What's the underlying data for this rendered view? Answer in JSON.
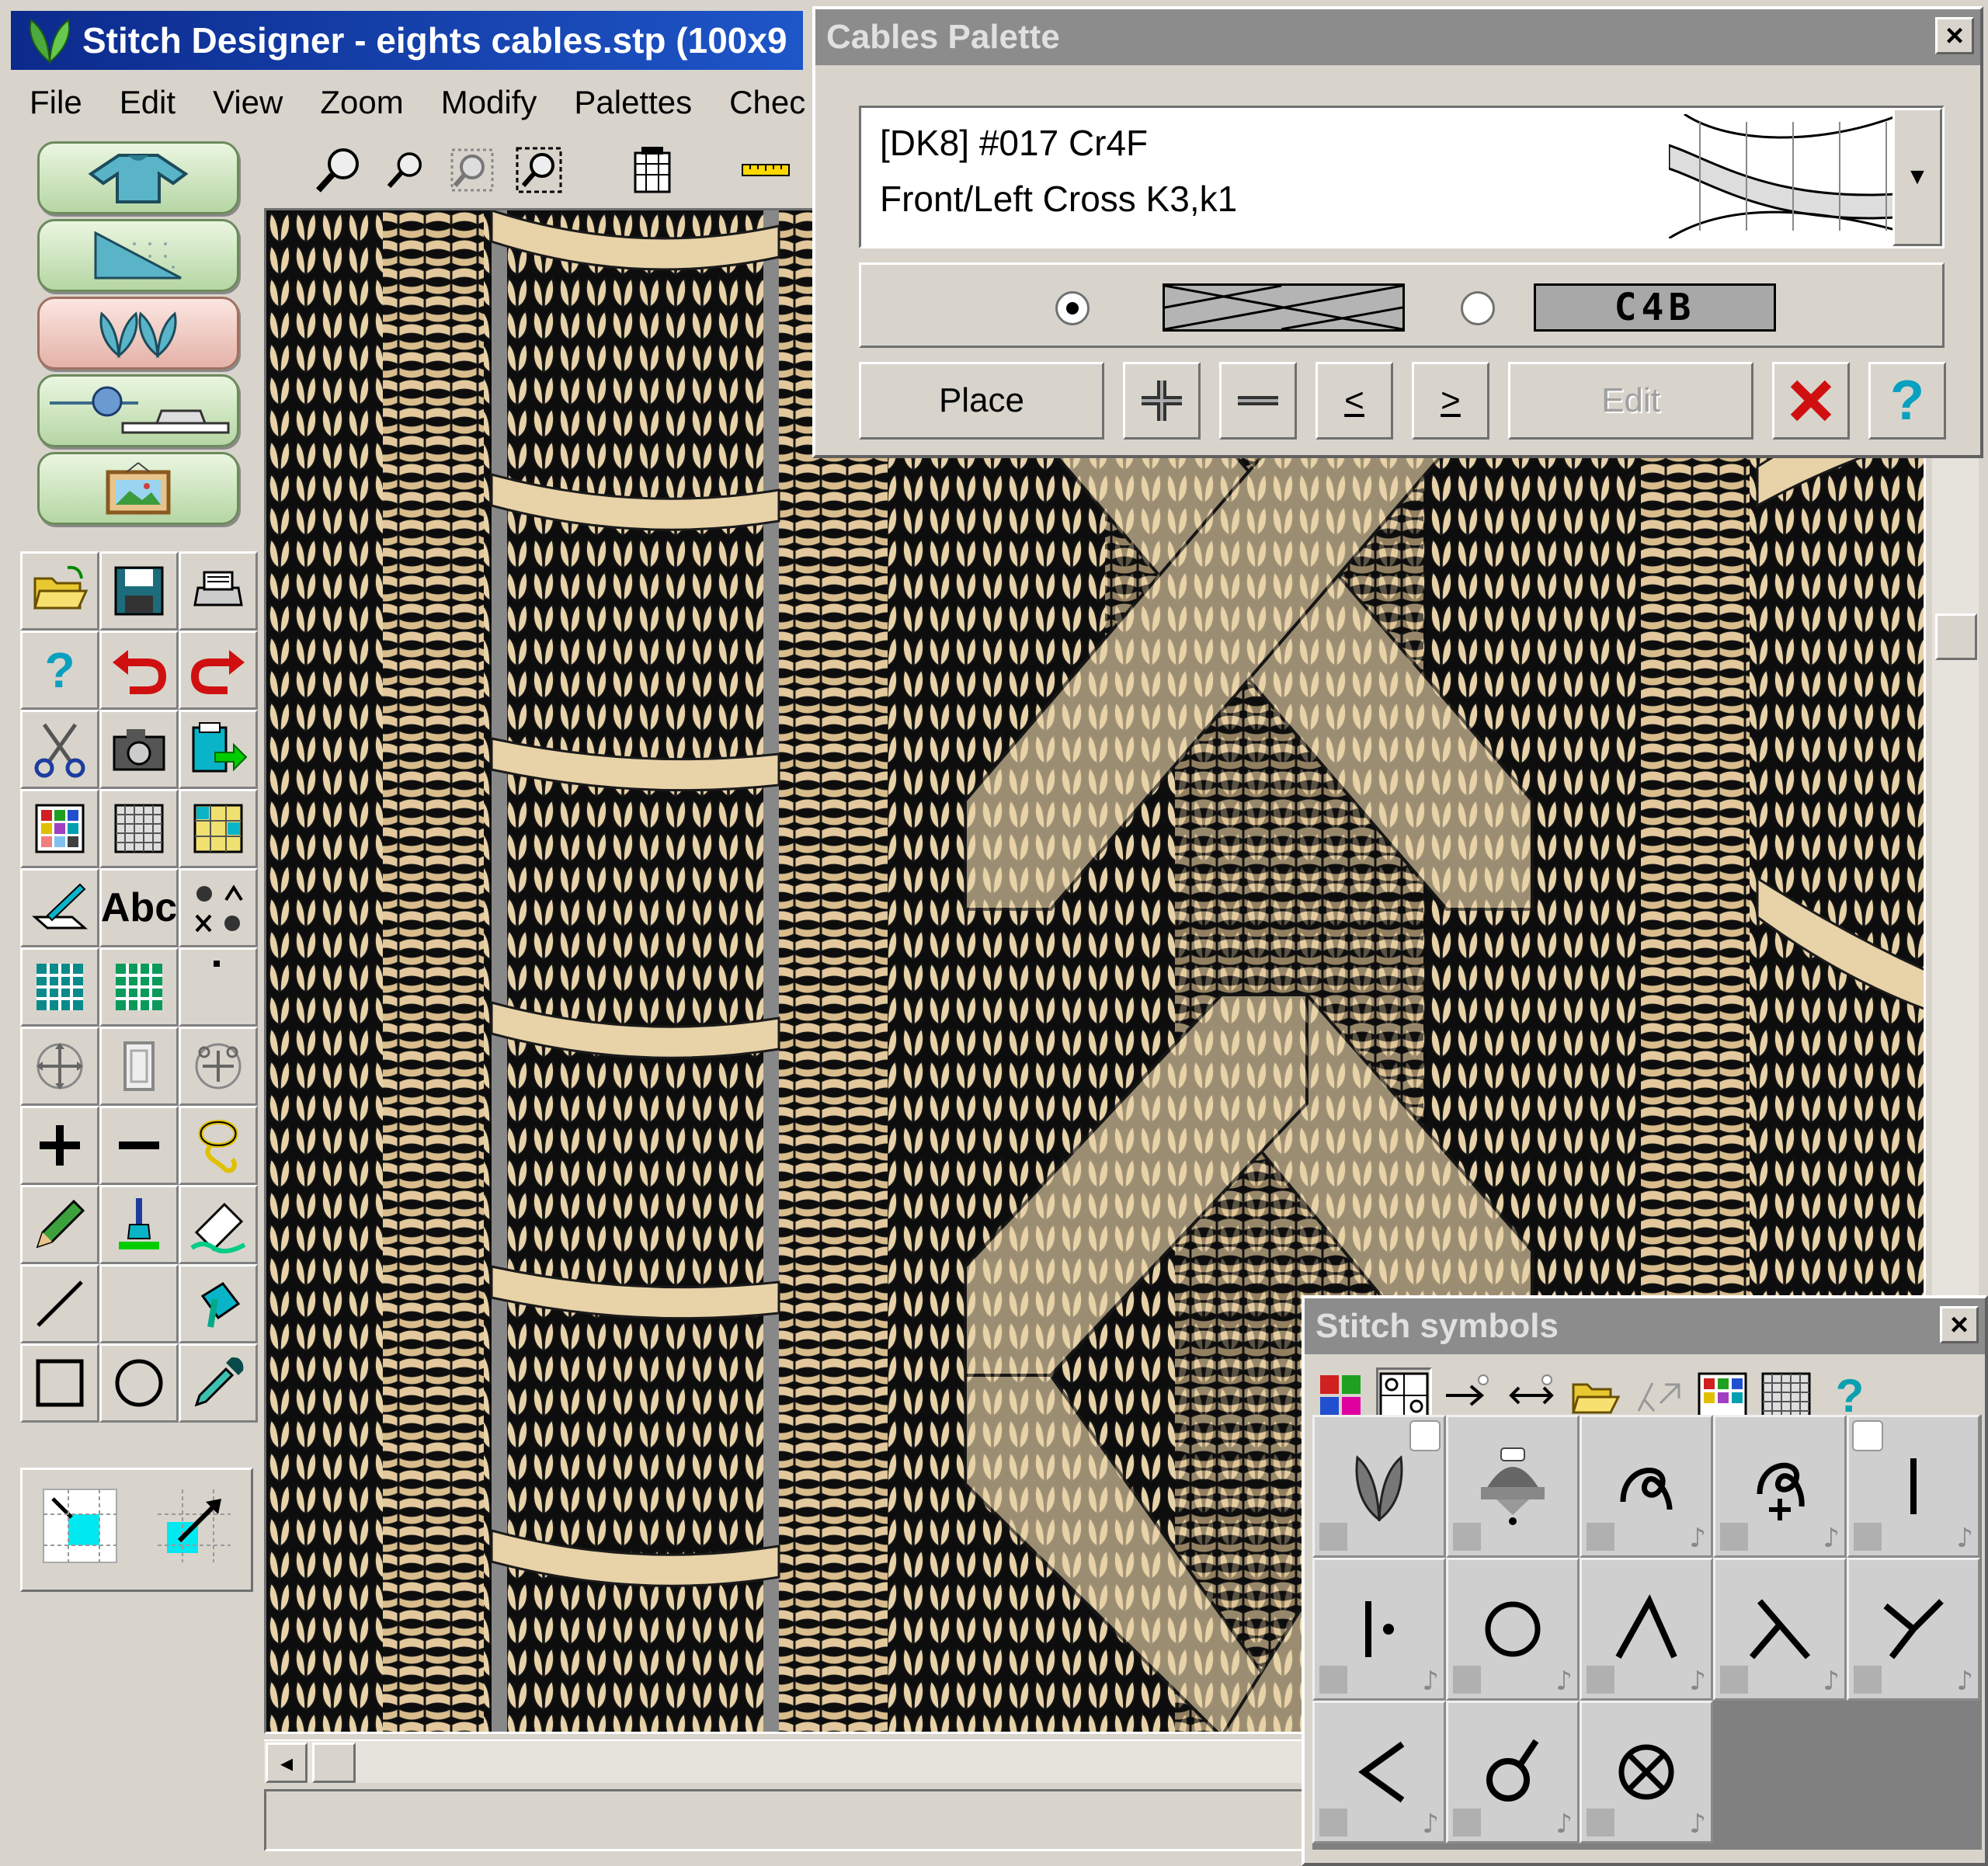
{
  "window": {
    "title": "Stitch Designer - eights cables.stp (100x9"
  },
  "menu": [
    "File",
    "Edit",
    "View",
    "Zoom",
    "Modify",
    "Palettes",
    "Chec"
  ],
  "left_toolbar": {
    "big_buttons": [
      "garment-shape-icon",
      "chart-shaping-icon",
      "stitch-leaf-icon",
      "knitting-machine-icon",
      "picture-frame-icon"
    ],
    "abc_label": "Abc"
  },
  "cables_palette": {
    "title": "Cables Palette",
    "selected_line1": "[DK8] #017  Cr4F",
    "selected_line2": "Front/Left Cross K3,k1",
    "radio_selected": "symbol",
    "alt_label": "C4B",
    "buttons": {
      "place": "Place",
      "plus": "+",
      "minus": "−",
      "prev": "<",
      "next": ">",
      "edit": "Edit"
    }
  },
  "stitch_symbols": {
    "title": "Stitch symbols",
    "help": "?"
  },
  "colors": {
    "yarn": "#e8d2a8",
    "shadow": "#1a1a1a",
    "titlebar": "#1e56c8",
    "palette_title": "#8c8c8c"
  }
}
